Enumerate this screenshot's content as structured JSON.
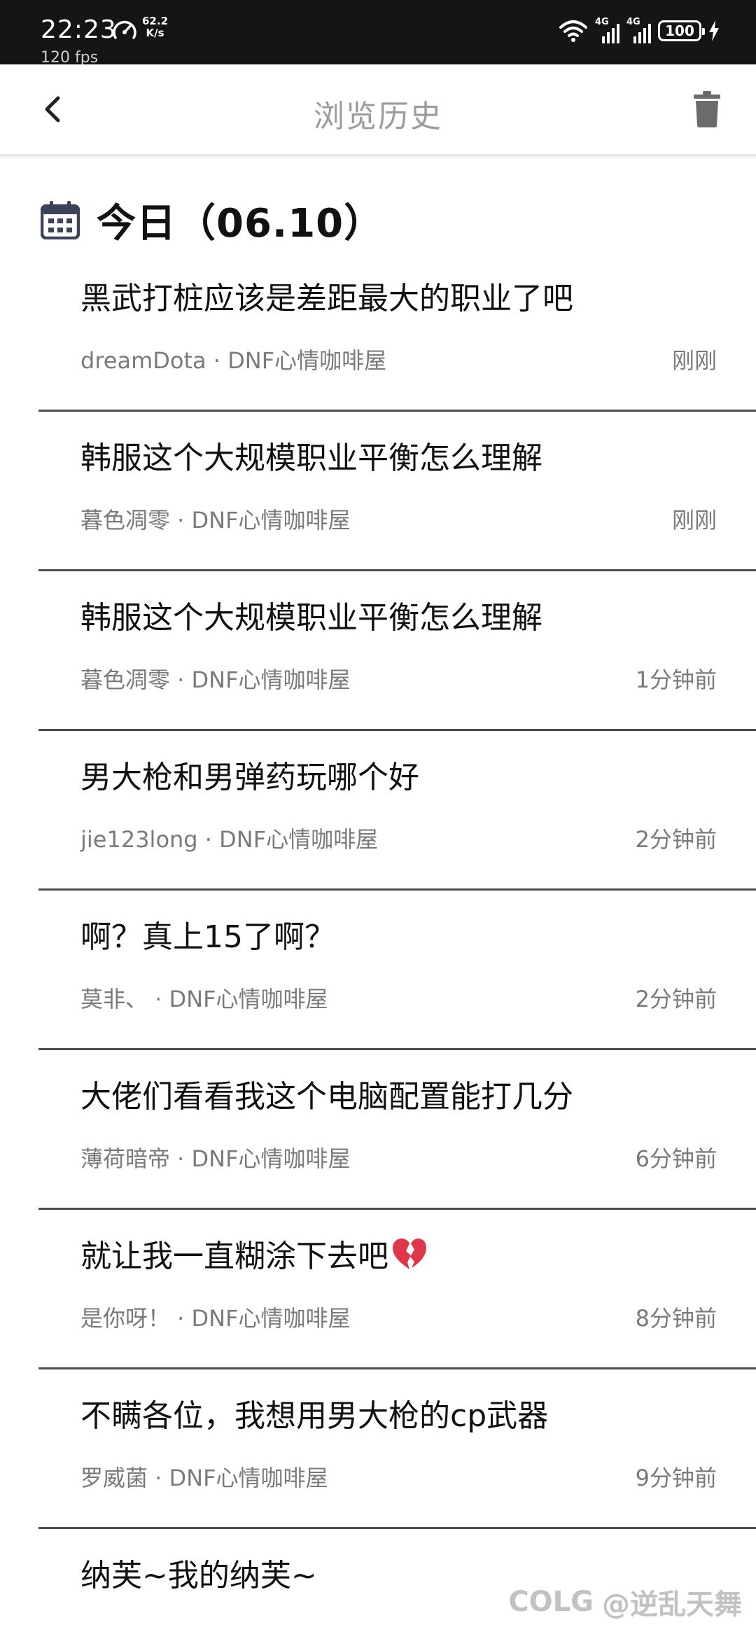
{
  "status_bar": {
    "time": "22:23",
    "speed_value": "62.2",
    "speed_unit": "K/s",
    "fps": "120 fps",
    "net1_tag": "4G",
    "net2_tag": "4G",
    "battery": "100"
  },
  "header": {
    "title": "浏览历史",
    "back_icon": "chevron-left-icon",
    "trash_icon": "trash-icon"
  },
  "section": {
    "title": "今日（06.10）",
    "icon": "calendar-icon"
  },
  "items": [
    {
      "title": "黑武打桩应该是差距最大的职业了吧",
      "meta": "dreamDota · DNF心情咖啡屋",
      "time": "刚刚"
    },
    {
      "title": "韩服这个大规模职业平衡怎么理解",
      "meta": "暮色凋零 · DNF心情咖啡屋",
      "time": "刚刚"
    },
    {
      "title": "韩服这个大规模职业平衡怎么理解",
      "meta": "暮色凋零 · DNF心情咖啡屋",
      "time": "1分钟前"
    },
    {
      "title": "男大枪和男弹药玩哪个好",
      "meta": "jie123long · DNF心情咖啡屋",
      "time": "2分钟前"
    },
    {
      "title": "啊？真上15了啊？",
      "meta": "莫非、 · DNF心情咖啡屋",
      "time": "2分钟前"
    },
    {
      "title": "大佬们看看我这个电脑配置能打几分",
      "meta": "薄荷暗帝 · DNF心情咖啡屋",
      "time": "6分钟前"
    },
    {
      "title": "就让我一直糊涂下去吧",
      "meta": "是你呀！ · DNF心情咖啡屋",
      "time": "8分钟前",
      "emoji": "broken-heart-icon"
    },
    {
      "title": "不瞒各位，我想用男大枪的cp武器",
      "meta": "罗威菌 · DNF心情咖啡屋",
      "time": "9分钟前"
    },
    {
      "title": "纳芙~我的纳芙~",
      "meta": "",
      "time": ""
    }
  ],
  "watermark": {
    "brand": "COLG",
    "user": "@逆乱天舞"
  },
  "colors": {
    "status_bar_bg": "#151515",
    "title_gray": "#9b9b9b",
    "meta_gray": "#7a7a7a",
    "divider": "#4d4d4d",
    "calendar_icon": "#3c4257"
  }
}
